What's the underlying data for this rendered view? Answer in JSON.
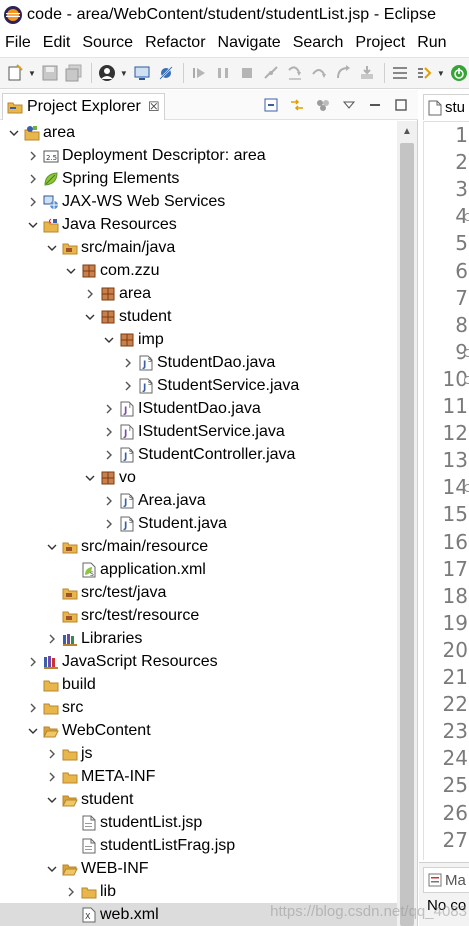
{
  "window": {
    "title": "code - area/WebContent/student/studentList.jsp - Eclipse"
  },
  "menu": [
    "File",
    "Edit",
    "Source",
    "Refactor",
    "Navigate",
    "Search",
    "Project",
    "Run"
  ],
  "explorer": {
    "tab_label": "Project Explorer",
    "tab_close": "☒",
    "tree": [
      {
        "label": "area",
        "depth": 0,
        "expand": "open",
        "icon": "project-icon"
      },
      {
        "label": "Deployment Descriptor: area",
        "depth": 1,
        "expand": "closed",
        "icon": "deployment-descriptor-icon"
      },
      {
        "label": "Spring Elements",
        "depth": 1,
        "expand": "closed",
        "icon": "spring-leaf-icon"
      },
      {
        "label": "JAX-WS Web Services",
        "depth": 1,
        "expand": "closed",
        "icon": "web-services-icon"
      },
      {
        "label": "Java Resources",
        "depth": 1,
        "expand": "open",
        "icon": "java-resources-icon"
      },
      {
        "label": "src/main/java",
        "depth": 2,
        "expand": "open",
        "icon": "source-folder-icon"
      },
      {
        "label": "com.zzu",
        "depth": 3,
        "expand": "open",
        "icon": "package-icon"
      },
      {
        "label": "area",
        "depth": 4,
        "expand": "closed",
        "icon": "package-icon"
      },
      {
        "label": "student",
        "depth": 4,
        "expand": "open",
        "icon": "package-icon"
      },
      {
        "label": "imp",
        "depth": 5,
        "expand": "open",
        "icon": "package-icon"
      },
      {
        "label": "StudentDao.java",
        "depth": 6,
        "expand": "closed",
        "icon": "java-file-icon"
      },
      {
        "label": "StudentService.java",
        "depth": 6,
        "expand": "closed",
        "icon": "java-file-icon"
      },
      {
        "label": "IStudentDao.java",
        "depth": 5,
        "expand": "closed",
        "icon": "java-interface-icon"
      },
      {
        "label": "IStudentService.java",
        "depth": 5,
        "expand": "closed",
        "icon": "java-interface-icon"
      },
      {
        "label": "StudentController.java",
        "depth": 5,
        "expand": "closed",
        "icon": "java-file-icon"
      },
      {
        "label": "vo",
        "depth": 4,
        "expand": "open",
        "icon": "package-icon"
      },
      {
        "label": "Area.java",
        "depth": 5,
        "expand": "closed",
        "icon": "java-file-icon"
      },
      {
        "label": "Student.java",
        "depth": 5,
        "expand": "closed",
        "icon": "java-file-icon"
      },
      {
        "label": "src/main/resource",
        "depth": 2,
        "expand": "open",
        "icon": "source-folder-icon"
      },
      {
        "label": "application.xml",
        "depth": 3,
        "expand": "none",
        "icon": "spring-xml-icon"
      },
      {
        "label": "src/test/java",
        "depth": 2,
        "expand": "none",
        "icon": "source-folder-icon"
      },
      {
        "label": "src/test/resource",
        "depth": 2,
        "expand": "none",
        "icon": "source-folder-icon"
      },
      {
        "label": "Libraries",
        "depth": 2,
        "expand": "closed",
        "icon": "libraries-icon"
      },
      {
        "label": "JavaScript Resources",
        "depth": 1,
        "expand": "closed",
        "icon": "javascript-resources-icon"
      },
      {
        "label": "build",
        "depth": 1,
        "expand": "none",
        "icon": "folder-icon"
      },
      {
        "label": "src",
        "depth": 1,
        "expand": "closed",
        "icon": "folder-icon"
      },
      {
        "label": "WebContent",
        "depth": 1,
        "expand": "open",
        "icon": "folder-open-icon"
      },
      {
        "label": "js",
        "depth": 2,
        "expand": "closed",
        "icon": "folder-icon"
      },
      {
        "label": "META-INF",
        "depth": 2,
        "expand": "closed",
        "icon": "folder-icon"
      },
      {
        "label": "student",
        "depth": 2,
        "expand": "open",
        "icon": "folder-open-icon"
      },
      {
        "label": "studentList.jsp",
        "depth": 3,
        "expand": "none",
        "icon": "jsp-file-icon"
      },
      {
        "label": "studentListFrag.jsp",
        "depth": 3,
        "expand": "none",
        "icon": "jsp-file-icon"
      },
      {
        "label": "WEB-INF",
        "depth": 2,
        "expand": "open",
        "icon": "folder-open-icon"
      },
      {
        "label": "lib",
        "depth": 3,
        "expand": "closed",
        "icon": "folder-icon"
      },
      {
        "label": "web.xml",
        "depth": 3,
        "expand": "none",
        "icon": "xml-file-icon",
        "selected": true
      }
    ]
  },
  "editor": {
    "tab_label": "stu",
    "line_numbers": [
      "1",
      "2",
      "3",
      "4",
      "5",
      "6",
      "7",
      "8",
      "9",
      "10",
      "11",
      "12",
      "13",
      "14",
      "15",
      "16",
      "17",
      "18",
      "19",
      "20",
      "21",
      "22",
      "23",
      "24",
      "25",
      "26",
      "27"
    ],
    "fold_lines": [
      "4",
      "9",
      "10",
      "14"
    ]
  },
  "bottom_panel": {
    "tab_label": "Ma",
    "text": "No co"
  },
  "watermark": "https://blog.csdn.net/qq_4083",
  "colors": {
    "package": "#a0522d",
    "folder": "#e8b64a",
    "java": "#3a5fa8",
    "selection": "#dcdcdc",
    "spring": "#6db33f"
  }
}
